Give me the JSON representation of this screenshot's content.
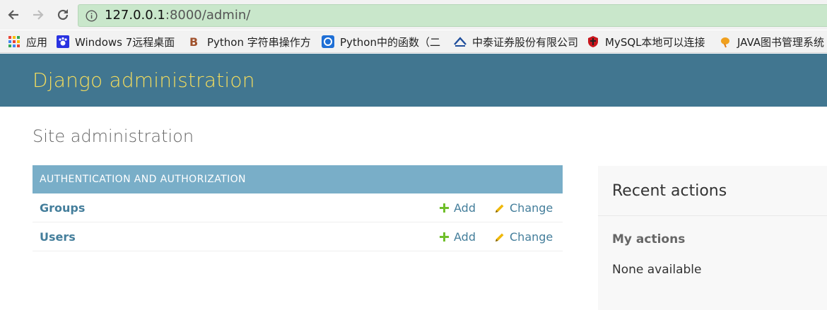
{
  "browser": {
    "url_host": "127.0.0.1",
    "url_rest": ":8000/admin/",
    "bookmarks": [
      {
        "label": "应用",
        "icon": "apps-grid-icon"
      },
      {
        "label": "Windows 7远程桌面",
        "icon": "baidu-paw-icon"
      },
      {
        "label": "Python 字符串操作方",
        "icon": "b-logo-icon"
      },
      {
        "label": "Python中的函数（二",
        "icon": "ring-logo-icon"
      },
      {
        "label": "中泰证券股份有限公司",
        "icon": "zt-logo-icon"
      },
      {
        "label": "MySQL本地可以连接",
        "icon": "shield-logo-icon"
      },
      {
        "label": "JAVA图书管理系统",
        "icon": "leaf-logo-icon"
      }
    ]
  },
  "header": {
    "site_name": "Django administration"
  },
  "page": {
    "title": "Site administration"
  },
  "module": {
    "caption": "AUTHENTICATION AND AUTHORIZATION",
    "rows": [
      {
        "name": "Groups",
        "add": "Add",
        "change": "Change"
      },
      {
        "name": "Users",
        "add": "Add",
        "change": "Change"
      }
    ]
  },
  "recent": {
    "title": "Recent actions",
    "my_actions": "My actions",
    "empty": "None available"
  },
  "colors": {
    "header_bg": "#417690",
    "site_name": "#f5dd5d",
    "caption_bg": "#79aec8",
    "link": "#447e9b",
    "add_icon": "#70bf2b",
    "change_icon": "#efb80b"
  }
}
